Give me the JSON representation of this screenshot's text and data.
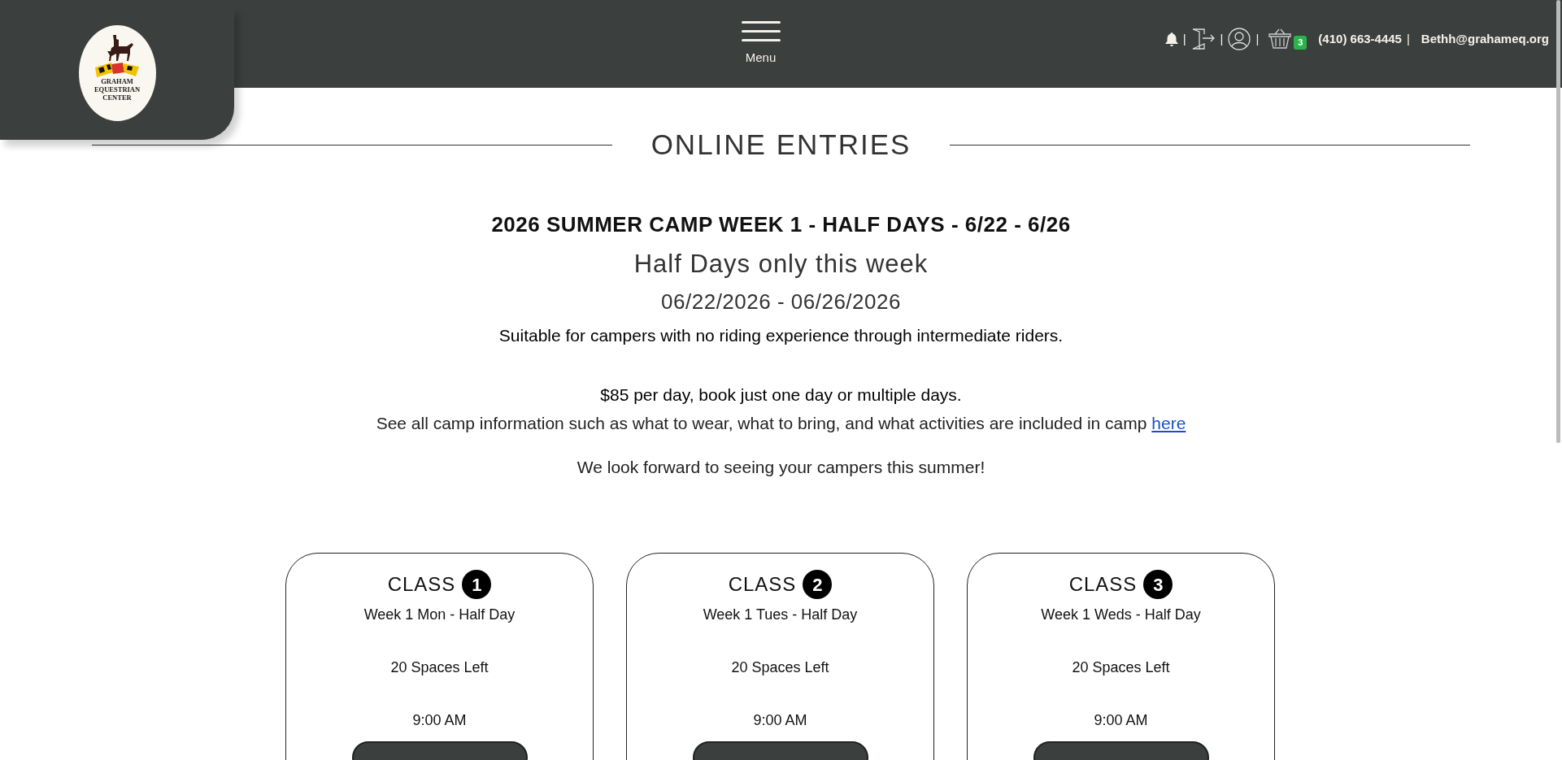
{
  "header": {
    "logo_lines": [
      "GRAHAM",
      "EQUESTRIAN",
      "CENTER"
    ],
    "menu_label": "Menu",
    "separators": [
      "|",
      "|",
      "|",
      "|"
    ],
    "cart_count": "3",
    "phone": "(410) 663-4445",
    "email": "Bethh@grahameq.org"
  },
  "section_title": "ONLINE ENTRIES",
  "event": {
    "title": "2026 SUMMER CAMP WEEK 1 - HALF DAYS - 6/22 - 6/26",
    "subtitle": "Half Days only this week",
    "dates": "06/22/2026 - 06/26/2026",
    "description": "Suitable for campers with no riding experience through intermediate riders.",
    "price": "$85 per day, book just one day or multiple days.",
    "info_text": "See all camp information such as what to wear, what to bring, and what activities are included in camp",
    "info_link": "here",
    "closing": "We look forward to seeing your campers this summer!"
  },
  "classes": [
    {
      "label": "CLASS",
      "number": "1",
      "name": "Week 1 Mon - Half Day",
      "spaces": "20 Spaces Left",
      "time": "9:00 AM"
    },
    {
      "label": "CLASS",
      "number": "2",
      "name": "Week 1 Tues - Half Day",
      "spaces": "20 Spaces Left",
      "time": "9:00 AM"
    },
    {
      "label": "CLASS",
      "number": "3",
      "name": "Week 1 Weds - Half Day",
      "spaces": "20 Spaces Left",
      "time": "9:00 AM"
    }
  ]
}
